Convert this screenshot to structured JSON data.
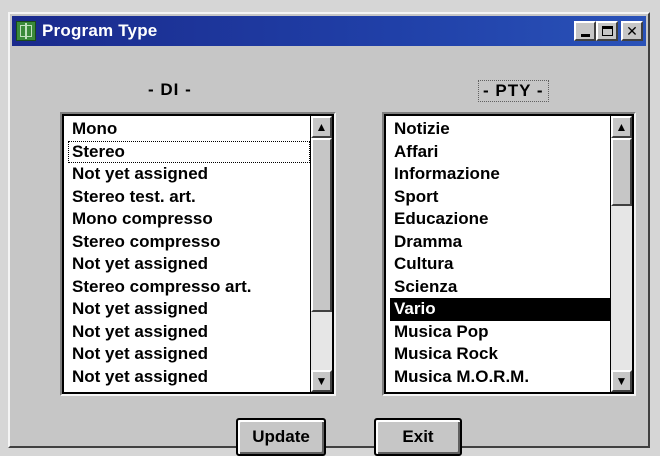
{
  "window": {
    "title": "Program Type"
  },
  "titlebar_buttons": {
    "close_glyph": "✕"
  },
  "di": {
    "label": "- DI -",
    "items": [
      "Mono",
      "Stereo",
      "Not yet assigned",
      "Stereo test. art.",
      "Mono compresso",
      "Stereo compresso",
      "Not yet assigned",
      "Stereo compresso art.",
      "Not yet assigned",
      "Not yet assigned",
      "Not yet assigned",
      "Not yet assigned"
    ],
    "focused_item": "Stereo"
  },
  "pty": {
    "label": "- PTY -",
    "items": [
      "Notizie",
      "Affari",
      "Informazione",
      "Sport",
      "Educazione",
      "Dramma",
      "Cultura",
      "Scienza",
      "Vario",
      "Musica Pop",
      "Musica Rock",
      "Musica M.O.R.M."
    ],
    "selected_item": "Vario"
  },
  "scroll": {
    "up_glyph": "▲",
    "down_glyph": "▼",
    "di_position": 0.0,
    "pty_position": 0.0
  },
  "buttons": {
    "update": "Update",
    "exit": "Exit"
  },
  "colors": {
    "title_bar": "#1a2a8c",
    "selection": "#000000",
    "window_face": "#c6c6c6"
  }
}
